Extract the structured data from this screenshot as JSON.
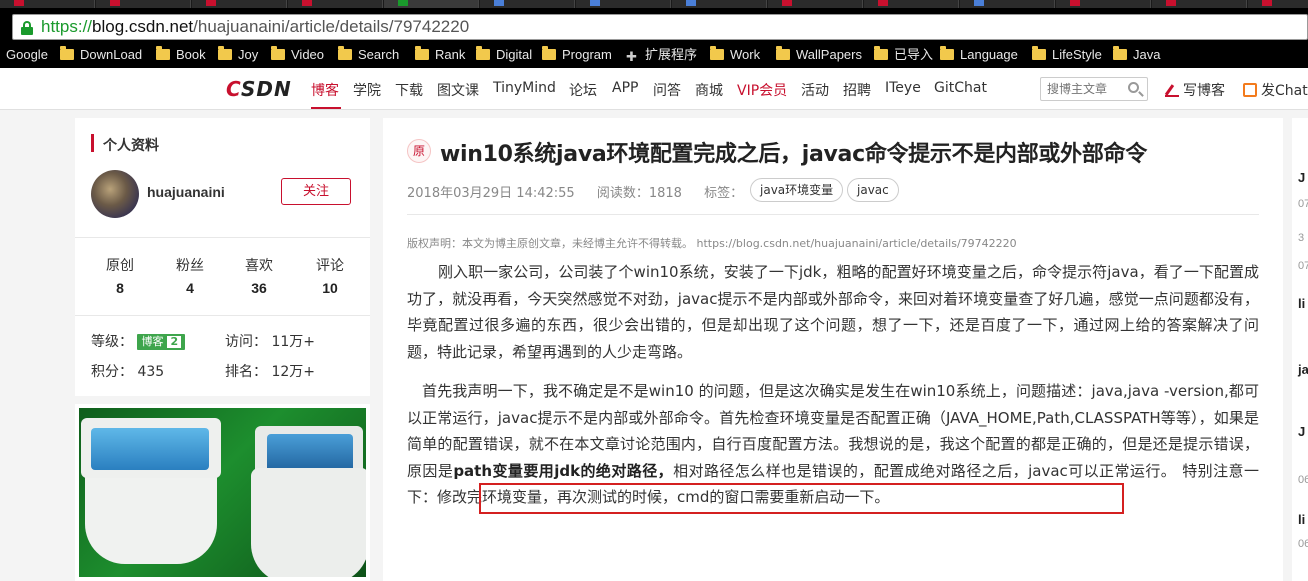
{
  "browser": {
    "url_scheme": "https://",
    "url_host": "blog.csdn.net",
    "url_path": "/huajuanaini/article/details/79742220",
    "bookmarks": [
      "Google",
      "DownLoad",
      "Book",
      "Joy",
      "Video",
      "Search",
      "Rank",
      "Digital",
      "Program",
      "扩展程序",
      "Work",
      "WallPapers",
      "已导入",
      "Language",
      "LifeStyle",
      "Java"
    ],
    "bookmark_icons": [
      "none",
      "folder-icon",
      "folder-icon",
      "folder-icon",
      "folder-icon",
      "folder-icon",
      "folder-icon",
      "folder-icon",
      "folder-icon",
      "puzzle-icon",
      "folder-icon",
      "folder-icon",
      "folder-icon",
      "folder-icon",
      "folder-icon",
      "folder-icon"
    ]
  },
  "nav": {
    "logo_c": "C",
    "logo_rest": "SDN",
    "items": [
      "博客",
      "学院",
      "下载",
      "图文课",
      "TinyMind",
      "论坛",
      "APP",
      "问答",
      "商城",
      "VIP会员",
      "活动",
      "招聘",
      "ITeye",
      "GitChat"
    ],
    "active": "博客",
    "search_placeholder": "搜博主文章",
    "write_blog": "写博客",
    "gitchat": "发Chat"
  },
  "profile": {
    "section_title": "个人资料",
    "username": "huajuanaini",
    "follow_label": "关注",
    "stats": [
      {
        "label": "原创",
        "value": "8"
      },
      {
        "label": "粉丝",
        "value": "4"
      },
      {
        "label": "喜欢",
        "value": "36"
      },
      {
        "label": "评论",
        "value": "10"
      }
    ],
    "level_label": "等级：",
    "level_badge": "博客",
    "level_num": "2",
    "visits_label": "访问：",
    "visits_value": "11万+",
    "points_label": "积分：",
    "points_value": "435",
    "rank_label": "排名：",
    "rank_value": "12万+"
  },
  "article": {
    "original_badge": "原",
    "title": "win10系统java环境配置完成之后，javac命令提示不是内部或外部命令",
    "date": "2018年03月29日 14:42:55",
    "reads_label": "阅读数：",
    "reads": "1818",
    "tags_label": "标签：",
    "tags": [
      "java环境变量",
      "javac"
    ],
    "copyright": "版权声明：本文为博主原创文章，未经博主允许不得转载。 https://blog.csdn.net/huajuanaini/article/details/79742220",
    "para1": "刚入职一家公司，公司装了个win10系统，安装了一下jdk，粗略的配置好环境变量之后，命令提示符java，看了一下配置成功了，就没再看，今天突然感觉不对劲，javac提示不是内部或外部命令，来回对着环境变量查了好几遍，感觉一点问题都没有，毕竟配置过很多遍的东西，很少会出错的，但是却出现了这个问题，想了一下，还是百度了一下，通过网上给的答案解决了问题，特此记录，希望再遇到的人少走弯路。",
    "para2_a": "首先我声明一下，我不确定是不是win10 的问题，但是这次确实是发生在win10系统上，问题描述：java,java -version,都可以正常运行，javac提示不是内部或外部命令。首先检查环境变量是否配置正确（JAVA_HOME,Path,CLASSPATH等等），如果是简单的配置错误，就不在本文章讨论范围内，自行百度配置方法。我想说的是，我这个配置的都是正确的，但是还是提示错误，原因是",
    "para2_bold": "path变量要用jdk的绝对路径，",
    "para2_b": "相对路径怎么样也是错误的，配置成绝对路径之后，javac可以正常运行。",
    "para2_note": "特别注意一下：修改完环境变量，再次测试的时候，cmd的窗口需要重新启动一下。"
  },
  "right_partial": [
    "J",
    "07",
    "3",
    "07",
    "li",
    "ja",
    "J",
    "06",
    "li",
    "06"
  ]
}
